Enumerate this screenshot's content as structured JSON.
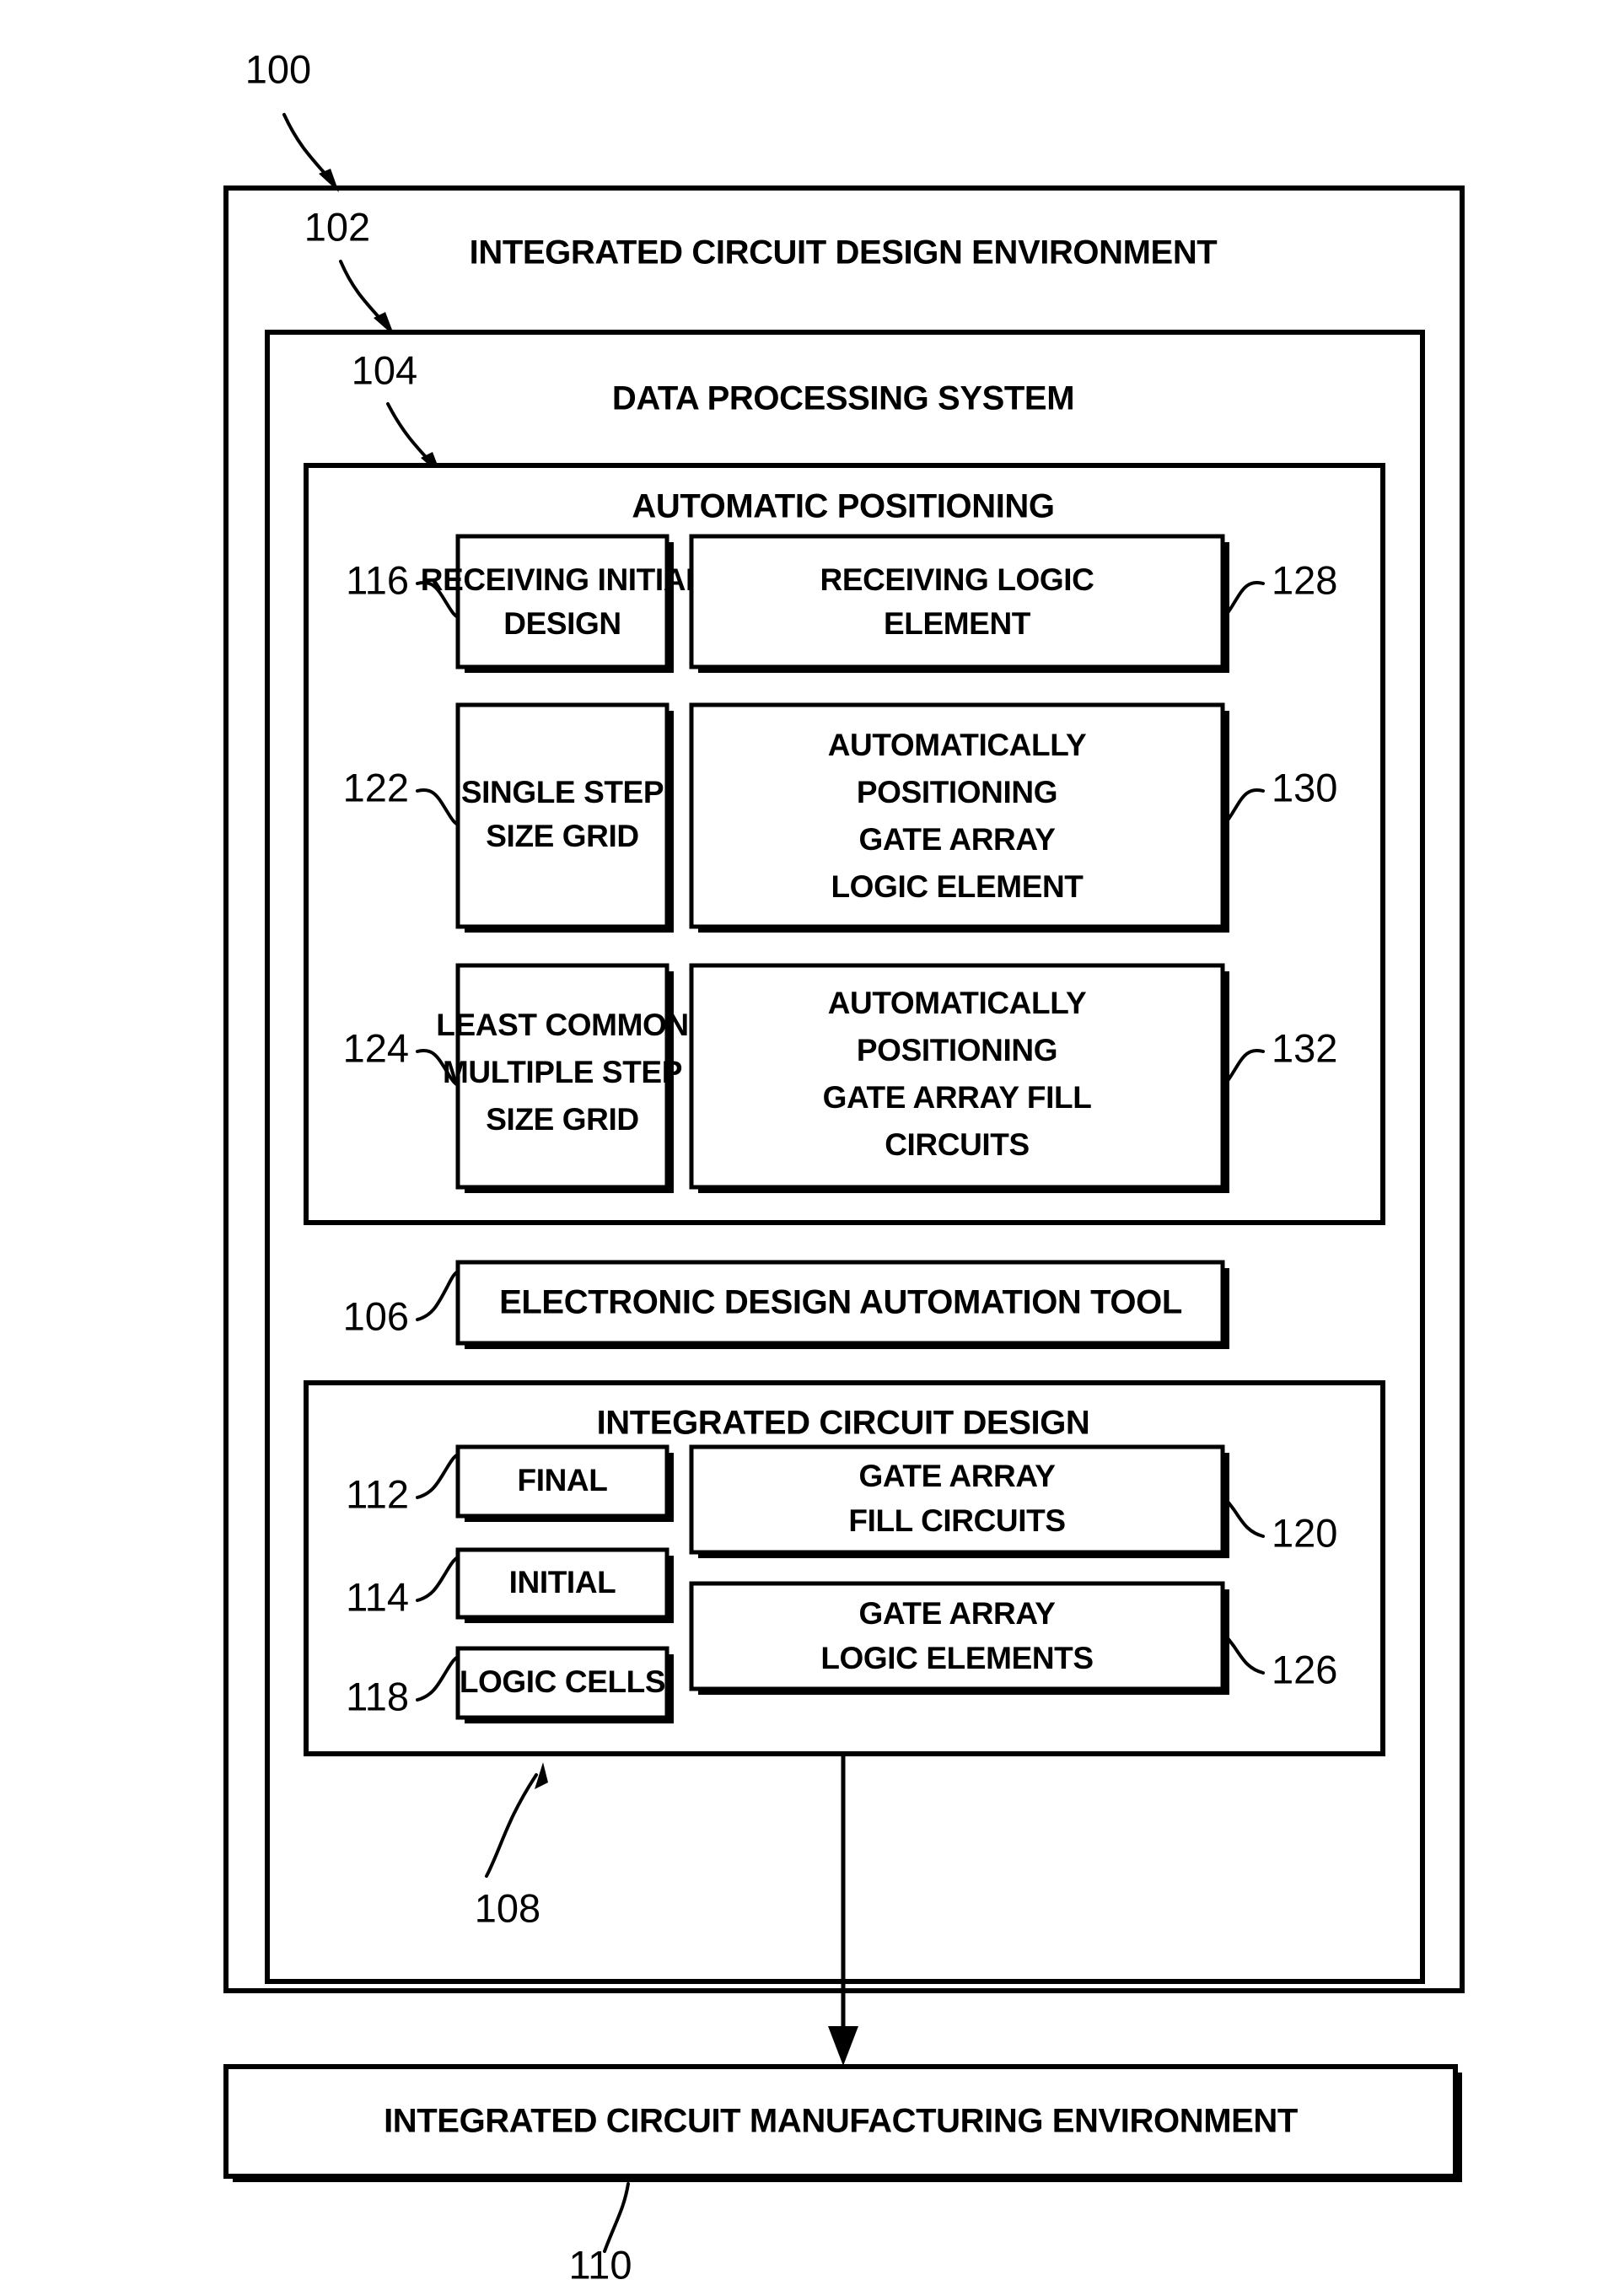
{
  "figure": {
    "title_outer": "INTEGRATED CIRCUIT DESIGN ENVIRONMENT",
    "ref_outer": "100",
    "ref_outer_inner": "102"
  },
  "data_processing_system": {
    "title": "DATA PROCESSING SYSTEM",
    "ref": "104"
  },
  "automatic_positioning": {
    "title": "AUTOMATIC POSITIONING",
    "boxes": [
      {
        "ref": "116",
        "side": "left",
        "lines": [
          "RECEIVING INITIAL",
          "DESIGN"
        ]
      },
      {
        "ref": "128",
        "side": "right",
        "lines": [
          "RECEIVING LOGIC",
          "ELEMENT"
        ]
      },
      {
        "ref": "122",
        "side": "left",
        "lines": [
          "SINGLE STEP",
          "SIZE GRID"
        ]
      },
      {
        "ref": "130",
        "side": "right",
        "lines": [
          "AUTOMATICALLY",
          "POSITIONING",
          "GATE ARRAY",
          "LOGIC ELEMENT"
        ]
      },
      {
        "ref": "124",
        "side": "left",
        "lines": [
          "LEAST COMMON",
          "MULTIPLE STEP",
          "SIZE GRID"
        ]
      },
      {
        "ref": "132",
        "side": "right",
        "lines": [
          "AUTOMATICALLY",
          "POSITIONING",
          "GATE ARRAY FILL",
          "CIRCUITS"
        ]
      }
    ]
  },
  "eda_tool": {
    "label": "ELECTRONIC DESIGN AUTOMATION TOOL",
    "ref": "106"
  },
  "integrated_circuit_design": {
    "title": "INTEGRATED CIRCUIT DESIGN",
    "ref": "108",
    "boxes": [
      {
        "ref": "112",
        "side": "left",
        "lines": [
          "FINAL"
        ]
      },
      {
        "ref": "120",
        "side": "right",
        "lines": [
          "GATE ARRAY",
          "FILL CIRCUITS"
        ]
      },
      {
        "ref": "114",
        "side": "left",
        "lines": [
          "INITIAL"
        ]
      },
      {
        "ref": "126",
        "side": "right",
        "lines": [
          "GATE ARRAY",
          "LOGIC ELEMENTS"
        ]
      },
      {
        "ref": "118",
        "side": "left",
        "lines": [
          "LOGIC CELLS"
        ]
      }
    ]
  },
  "manufacturing_environment": {
    "label": "INTEGRATED CIRCUIT MANUFACTURING ENVIRONMENT",
    "ref": "110"
  },
  "colors": {
    "line": "#000000",
    "fill": "#ffffff"
  }
}
